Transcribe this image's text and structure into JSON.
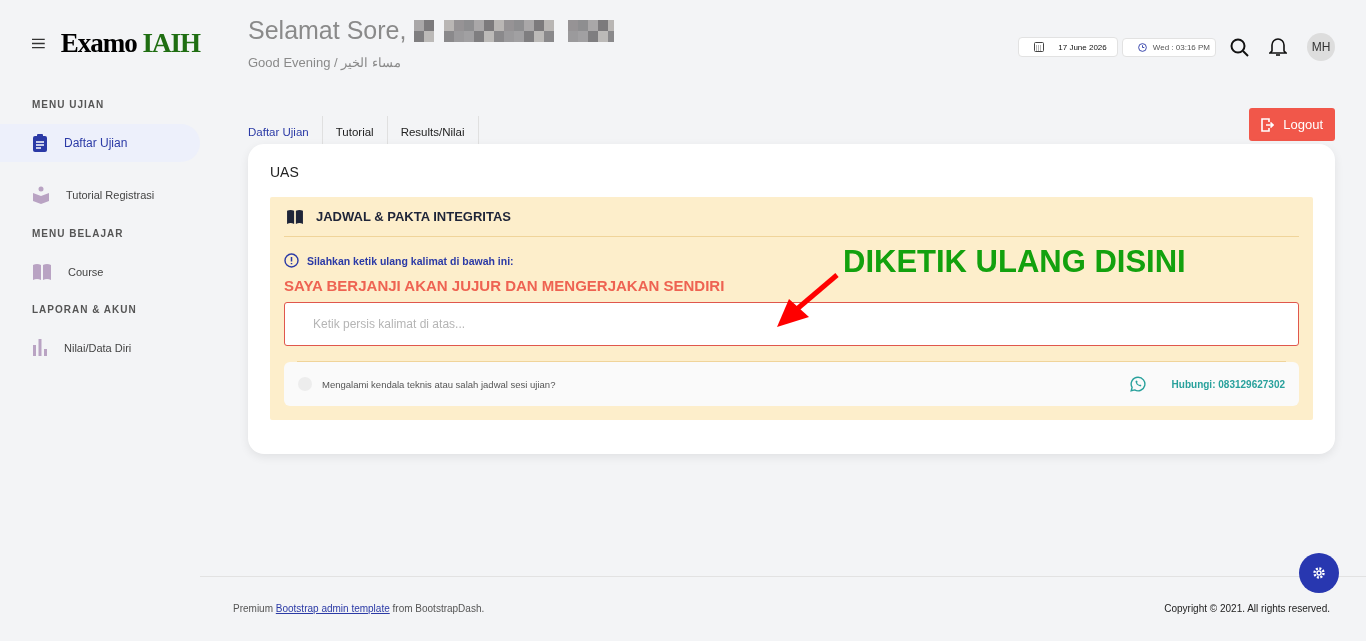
{
  "brand": {
    "name": "Examo",
    "accent": "IAIH"
  },
  "greeting": {
    "title": "Selamat Sore,",
    "subtitle": "Good Evening / مساء الخير"
  },
  "header": {
    "date": "17 June 2026",
    "time": "Wed : 03:16 PM",
    "avatar": "MH"
  },
  "sidebar": [
    {
      "heading": "MENU UJIAN",
      "items": [
        {
          "label": "Daftar Ujian",
          "kind": "clipboard",
          "selected": true
        },
        {
          "label": "Tutorial Registrasi",
          "kind": "reader",
          "selected": false
        }
      ]
    },
    {
      "heading": "MENU BELAJAR",
      "items": [
        {
          "label": "Course",
          "kind": "book",
          "selected": false
        }
      ]
    },
    {
      "heading": "LAPORAN & AKUN",
      "items": [
        {
          "label": "Nilai/Data Diri",
          "kind": "chart",
          "selected": false
        }
      ]
    }
  ],
  "tabs": [
    {
      "label": "Daftar Ujian",
      "selected": true
    },
    {
      "label": "Tutorial",
      "selected": false
    },
    {
      "label": "Results/Nilai",
      "selected": false
    }
  ],
  "logout": "Logout",
  "card": {
    "title": "UAS",
    "panel_title": "JADWAL & PAKTA INTEGRITAS",
    "instruction": "Silahkan ketik ulang kalimat di bawah ini:",
    "pledge": "SAYA BERJANJI AKAN JUJUR DAN MENGERJAKAN SENDIRI",
    "input": {
      "placeholder": "Ketik persis kalimat di atas..."
    },
    "help": "Mengalami kendala teknis atau salah jadwal sesi ujian?",
    "contact": "Hubungi: 083129627302"
  },
  "annotation": {
    "text": "DIKETIK ULANG DISINI"
  },
  "footer": {
    "prefix": "Premium",
    "link": "Bootstrap admin template",
    "suffix": "from BootstrapDash.",
    "copyright": "Copyright © 2021. All rights reserved."
  }
}
